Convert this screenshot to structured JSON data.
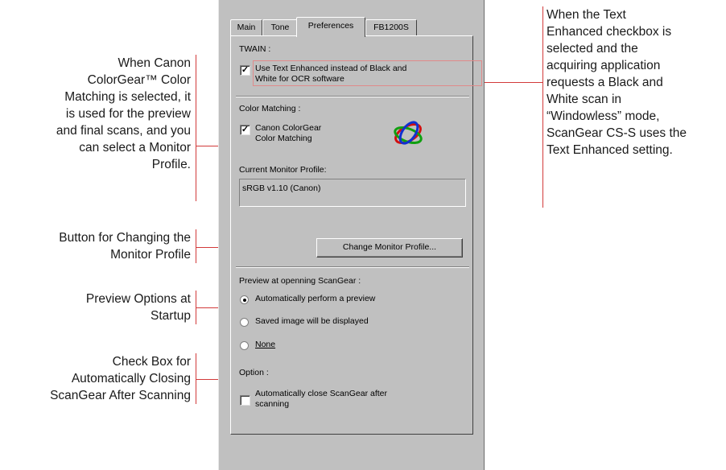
{
  "dialog": {
    "tabs": [
      {
        "label": "Main"
      },
      {
        "label": "Tone"
      },
      {
        "label": "Preferences"
      },
      {
        "label": "FB1200S"
      }
    ],
    "twain": {
      "section_label": "TWAIN :",
      "checkbox_label_line1": "Use Text Enhanced instead of Black and",
      "checkbox_label_line2": "White for OCR software",
      "checked": true
    },
    "color_matching": {
      "section_label": "Color Matching :",
      "checkbox_label_line1": "Canon ColorGear",
      "checkbox_label_line2": "Color Matching",
      "checked": true,
      "logo_icon": "colorgear-logo-icon",
      "current_profile_label": "Current Monitor Profile:",
      "current_profile_value": "sRGB v1.10 (Canon)",
      "change_button": "Change Monitor Profile..."
    },
    "preview": {
      "section_label": "Preview at openning ScanGear :",
      "options": [
        {
          "label": "Automatically perform a preview",
          "selected": true
        },
        {
          "label": "Saved image will be displayed",
          "selected": false
        },
        {
          "label": "None",
          "selected": false
        }
      ]
    },
    "option": {
      "section_label": "Option :",
      "checkbox_label_line1": "Automatically close ScanGear after",
      "checkbox_label_line2": "scanning",
      "checked": false
    }
  },
  "callouts": {
    "color_matching": {
      "lines": [
        "When Canon",
        "ColorGear™ Color",
        "Matching is selected, it",
        "is used for the preview",
        "and final scans, and you",
        "can select a Monitor",
        "Profile."
      ]
    },
    "change_profile": {
      "lines": [
        "Button for Changing the",
        "Monitor Profile"
      ]
    },
    "preview_options": {
      "lines": [
        "Preview Options at",
        "Startup"
      ]
    },
    "auto_close": {
      "lines": [
        "Check Box for",
        "Automatically Closing",
        "ScanGear After Scanning"
      ]
    },
    "text_enhanced": {
      "lines": [
        "When the Text",
        "Enhanced checkbox is",
        "selected and the",
        "acquiring application",
        "requests a Black and",
        "White scan in",
        "“Windowless” mode,",
        "ScanGear CS-S uses the",
        "Text Enhanced setting."
      ]
    }
  },
  "colors": {
    "accent_line": "#d23a3a",
    "dialog_face": "#c0c0c0"
  }
}
